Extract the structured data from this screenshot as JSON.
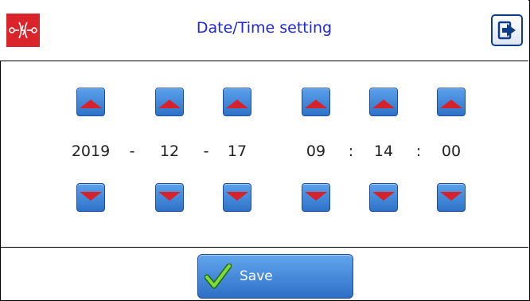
{
  "header": {
    "title": "Date/Time setting",
    "logo_icon": "tesla-coil-logo-icon",
    "exit_icon": "exit-icon"
  },
  "datetime": {
    "year": "2019",
    "month": "12",
    "day": "17",
    "hour": "09",
    "minute": "14",
    "second": "00",
    "date_separator": "-",
    "time_separator": ":"
  },
  "controls": {
    "up_icon": "arrow-up-icon",
    "down_icon": "arrow-down-icon"
  },
  "footer": {
    "save_label": "Save",
    "save_icon": "checkmark-icon"
  },
  "colors": {
    "title": "#1f27d6",
    "logo_bg": "#d8242a",
    "button_blue": "#3a7fd4",
    "arrow_red": "#d6232b"
  }
}
